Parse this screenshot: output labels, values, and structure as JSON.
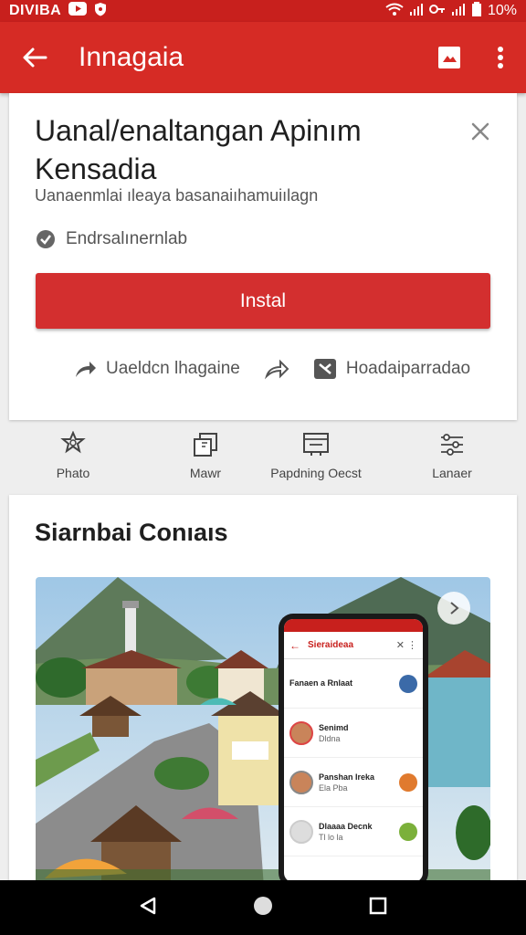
{
  "status_bar": {
    "carrier": "DIVIBA",
    "battery_text": "10%"
  },
  "app_bar": {
    "title": "Innagaia"
  },
  "app_card": {
    "title": "Uanal/enaltangan Apinım Kensadia",
    "subtitle": "Uanaenmlai ıleaya basanaiıhamuiılagn",
    "developer": "Endrsalınernlab",
    "install_label": "Instal",
    "share_label": "Uaeldcn lhagaine",
    "wishlist_label": "Hoadaiparradao"
  },
  "tabs": [
    {
      "label": "Phato",
      "icon": "badge-icon"
    },
    {
      "label": "Mawr",
      "icon": "copy-icon"
    },
    {
      "label": "Papdning Oecst",
      "icon": "card-icon"
    },
    {
      "label": "Lanaer",
      "icon": "settings-icon"
    }
  ],
  "screenshots_section": {
    "title": "Siarnbai Conıaıs",
    "phone": {
      "title": "Sieraideaa",
      "items": [
        {
          "title": "Fanaen a Rnlaat",
          "sub": ""
        },
        {
          "title": "Senimd",
          "sub": "Dldna"
        },
        {
          "title": "Panshan Ireka",
          "sub": "Ela Pba"
        },
        {
          "title": "Dlaaaa Decnk",
          "sub": "Tl lo la"
        }
      ]
    }
  },
  "colors": {
    "primary": "#d62b25",
    "status": "#c8201d",
    "install": "#d32f2f"
  }
}
